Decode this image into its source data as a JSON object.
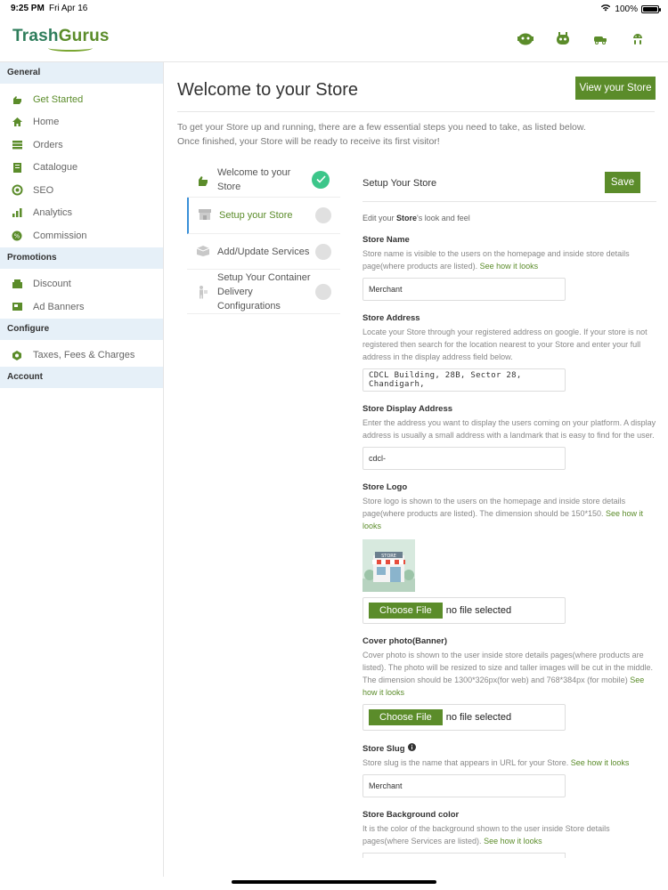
{
  "status": {
    "time": "9:25 PM",
    "date": "Fri Apr 16",
    "battery": "100%"
  },
  "brand": {
    "name_part1": "Trash",
    "name_part2": "Gurus"
  },
  "header_icons": [
    "chat-bot-icon",
    "robot-icon",
    "truck-icon",
    "android-icon"
  ],
  "sidebar": {
    "sections": [
      {
        "label": "General",
        "items": [
          {
            "label": "Get Started",
            "icon": "hand-icon"
          },
          {
            "label": "Home",
            "icon": "home-icon"
          },
          {
            "label": "Orders",
            "icon": "orders-icon"
          },
          {
            "label": "Catalogue",
            "icon": "catalogue-icon"
          },
          {
            "label": "SEO",
            "icon": "seo-icon"
          },
          {
            "label": "Analytics",
            "icon": "analytics-icon"
          },
          {
            "label": "Commission",
            "icon": "commission-icon"
          }
        ]
      },
      {
        "label": "Promotions",
        "items": [
          {
            "label": "Discount",
            "icon": "discount-icon"
          },
          {
            "label": "Ad Banners",
            "icon": "banner-icon"
          }
        ]
      },
      {
        "label": "Configure",
        "items": [
          {
            "label": "Taxes, Fees & Charges",
            "icon": "tax-icon"
          }
        ]
      },
      {
        "label": "Account",
        "items": []
      }
    ]
  },
  "main": {
    "title": "Welcome to your Store",
    "view_store_label": "View your Store",
    "intro_line1": "To get your Store up and running, there are a few essential steps you need to take, as listed below.",
    "intro_line2": "Once finished, your Store will be ready to receive its first visitor!"
  },
  "steps": [
    {
      "label": "Welcome to your Store",
      "status": "done"
    },
    {
      "label": "Setup your Store",
      "status": "active"
    },
    {
      "label": "Add/Update Services",
      "status": "pending"
    },
    {
      "label": "Setup Your Container Delivery Configurations",
      "status": "pending"
    }
  ],
  "form": {
    "title": "Setup Your Store",
    "save_label": "Save",
    "edit_note_pre": "Edit your ",
    "edit_note_bold": "Store",
    "edit_note_post": "'s look and feel",
    "store_name": {
      "label": "Store Name",
      "desc": "Store name is visible to the users on the homepage and inside store details page(where products are listed). ",
      "link": "See how it looks",
      "value": "Merchant"
    },
    "store_address": {
      "label": "Store Address",
      "desc": "Locate your Store through your registered address on google. If your store is not registered then search for the location nearest to your Store and enter your full address in the display address field below.",
      "value": "CDCL Building, 28B, Sector 28, Chandigarh,"
    },
    "display_address": {
      "label": "Store Display Address",
      "desc": "Enter the address you want to display the users coming on your platform. A display address is usually a small address with a landmark that is easy to find for the user.",
      "value": "cdcl-"
    },
    "store_logo": {
      "label": "Store Logo",
      "desc": "Store logo is shown to the users on the homepage and inside store details page(where products are listed). The dimension should be 150*150. ",
      "link": "See how it looks",
      "image_text": "STORE",
      "choose_label": "Choose File",
      "file_status": "no file selected"
    },
    "cover_photo": {
      "label": "Cover photo(Banner)",
      "desc": "Cover photo is shown to the user inside store details pages(where products are listed). The photo will be resized to size and taller images will be cut in the middle. The dimension should be 1300*326px(for web) and 768*384px (for mobile) ",
      "link": "See how it looks",
      "choose_label": "Choose File",
      "file_status": "no file selected"
    },
    "store_slug": {
      "label": "Store Slug",
      "desc": "Store slug is the name that appears in URL for your Store. ",
      "link": "See how it looks",
      "value": "Merchant"
    },
    "bg_color": {
      "label": "Store Background color",
      "desc": "It is the color of the background shown to the user inside Store details pages(where Services are listed). ",
      "link": "See how it looks"
    }
  },
  "colors": {
    "accent": "#5b8c2a",
    "section_bg": "#e6f0f8",
    "step_done": "#3cc68a",
    "active_border": "#3a8fd8"
  }
}
